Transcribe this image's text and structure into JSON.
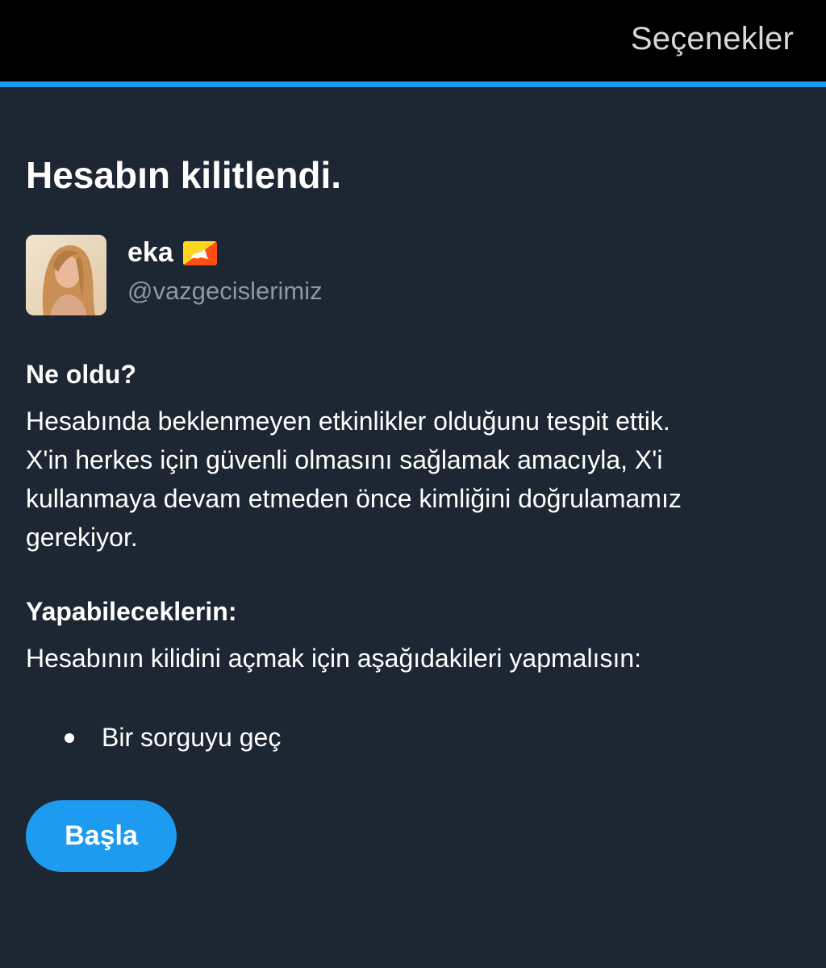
{
  "header": {
    "options_label": "Seçenekler",
    "accent_color": "#1d9bf0"
  },
  "main": {
    "title": "Hesabın kilitlendi.",
    "profile": {
      "display_name": "eka",
      "flag_emoji": "bhutan-flag",
      "handle": "@vazgecislerimiz"
    },
    "what_happened": {
      "heading": "Ne oldu?",
      "lines": [
        "Hesabında beklenmeyen etkinlikler olduğunu tespit ettik.",
        "X'in herkes için güvenli olmasını sağlamak amacıyla, X'i",
        "kullanmaya devam etmeden önce kimliğini doğrulamamız",
        "gerekiyor."
      ]
    },
    "what_you_can_do": {
      "heading": "Yapabileceklerin:",
      "text": "Hesabının kilidini açmak için aşağıdakileri yapmalısın:",
      "items": [
        "Bir sorguyu geç"
      ]
    },
    "start_button_label": "Başla"
  },
  "colors": {
    "background": "#1c2733",
    "topbar": "#000000",
    "secondary_text": "#8b98a5",
    "button": "#1d9bf0"
  }
}
